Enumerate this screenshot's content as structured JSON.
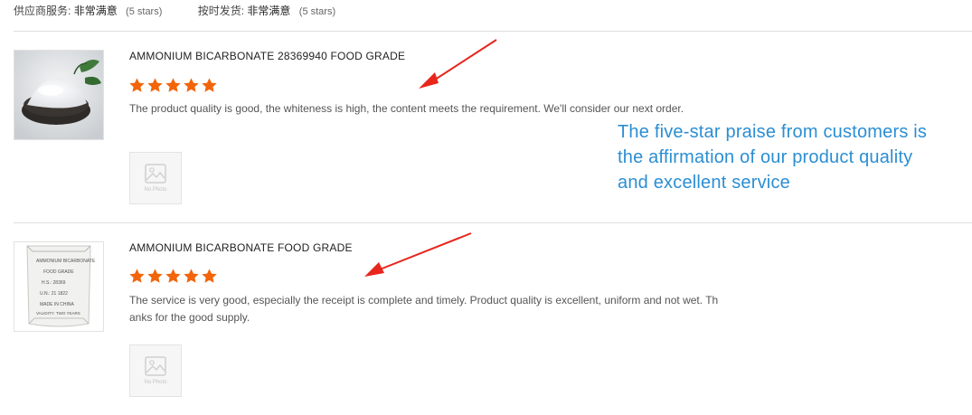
{
  "summary": {
    "supplier_service_label": "供应商服务:",
    "supplier_service_value": "非常满意",
    "supplier_service_stars": "(5 stars)",
    "on_time_label": "按时发货:",
    "on_time_value": "非常满意",
    "on_time_stars": "(5 stars)"
  },
  "reviews": [
    {
      "title": "AMMONIUM BICARBONATE 28369940 FOOD GRADE",
      "rating": 5,
      "text": "The product quality is good, the whiteness is high, the content meets the requirement. We'll consider our next order.",
      "no_photo_label": "No Photo",
      "product_image_icon": "white-powder-bowl-icon"
    },
    {
      "title": "AMMONIUM BICARBONATE FOOD GRADE",
      "rating": 5,
      "text": "The service is very good, especially the receipt is complete and timely. Product quality is excellent, uniform and not wet. Thanks for the good supply.",
      "no_photo_label": "No Photo",
      "product_image_icon": "product-bag-icon",
      "bag_lines": [
        "AMMONIUM BICARBONATE",
        "FOOD GRADE",
        "H.S.: 28369",
        "U.N.: 21 1822",
        "MADE IN CHINA",
        "VALIDITY: TWO YEARS"
      ]
    }
  ],
  "annotation": {
    "caption": "The five-star praise from customers is the affirmation of our product quality and excellent service"
  },
  "colors": {
    "star": "#f2650a",
    "caption": "#2b8ed3",
    "arrow": "#e8261c"
  }
}
